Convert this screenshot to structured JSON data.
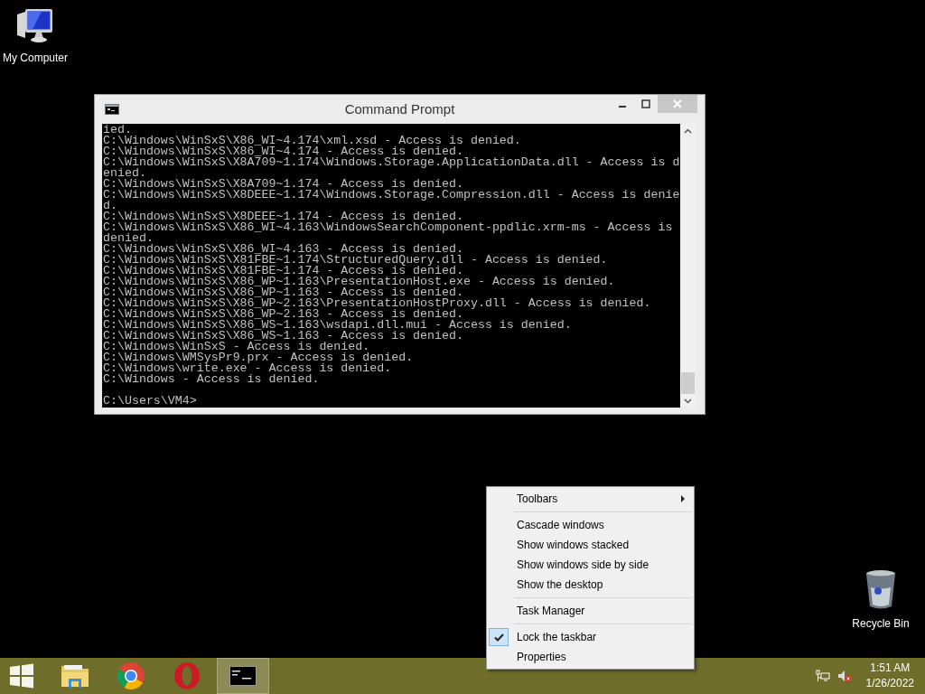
{
  "desktop_icons": [
    {
      "kind": "computer",
      "label": "My Computer"
    },
    {
      "kind": "recycle",
      "label": "Recycle Bin"
    }
  ],
  "window": {
    "title": "Command Prompt",
    "lines": [
      "ied.",
      "C:\\Windows\\WinSxS\\X86_WI~4.174\\xml.xsd - Access is denied.",
      "C:\\Windows\\WinSxS\\X86_WI~4.174 - Access is denied.",
      "C:\\Windows\\WinSxS\\X8A709~1.174\\Windows.Storage.ApplicationData.dll - Access is d",
      "enied.",
      "C:\\Windows\\WinSxS\\X8A709~1.174 - Access is denied.",
      "C:\\Windows\\WinSxS\\X8DEEE~1.174\\Windows.Storage.Compression.dll - Access is denie",
      "d.",
      "C:\\Windows\\WinSxS\\X8DEEE~1.174 - Access is denied.",
      "C:\\Windows\\WinSxS\\X86_WI~4.163\\WindowsSearchComponent-ppdlic.xrm-ms - Access is",
      "denied.",
      "C:\\Windows\\WinSxS\\X86_WI~4.163 - Access is denied.",
      "C:\\Windows\\WinSxS\\X81FBE~1.174\\StructuredQuery.dll - Access is denied.",
      "C:\\Windows\\WinSxS\\X81FBE~1.174 - Access is denied.",
      "C:\\Windows\\WinSxS\\X86_WP~1.163\\PresentationHost.exe - Access is denied.",
      "C:\\Windows\\WinSxS\\X86_WP~1.163 - Access is denied.",
      "C:\\Windows\\WinSxS\\X86_WP~2.163\\PresentationHostProxy.dll - Access is denied.",
      "C:\\Windows\\WinSxS\\X86_WP~2.163 - Access is denied.",
      "C:\\Windows\\WinSxS\\X86_WS~1.163\\wsdapi.dll.mui - Access is denied.",
      "C:\\Windows\\WinSxS\\X86_WS~1.163 - Access is denied.",
      "C:\\Windows\\WinSxS - Access is denied.",
      "C:\\Windows\\WMSysPr9.prx - Access is denied.",
      "C:\\Windows\\write.exe - Access is denied.",
      "C:\\Windows - Access is denied."
    ],
    "prompt": "C:\\Users\\VM4>"
  },
  "context_menu": {
    "groups": [
      {
        "items": [
          {
            "label": "Toolbars",
            "submenu": true,
            "checked": false
          }
        ]
      },
      {
        "items": [
          {
            "label": "Cascade windows",
            "submenu": false,
            "checked": false
          },
          {
            "label": "Show windows stacked",
            "submenu": false,
            "checked": false
          },
          {
            "label": "Show windows side by side",
            "submenu": false,
            "checked": false
          },
          {
            "label": "Show the desktop",
            "submenu": false,
            "checked": false
          }
        ]
      },
      {
        "items": [
          {
            "label": "Task Manager",
            "submenu": false,
            "checked": false
          }
        ]
      },
      {
        "items": [
          {
            "label": "Lock the taskbar",
            "submenu": false,
            "checked": true
          },
          {
            "label": "Properties",
            "submenu": false,
            "checked": false
          }
        ]
      }
    ]
  },
  "taskbar": {
    "apps": [
      {
        "kind": "explorer",
        "selected": false
      },
      {
        "kind": "chrome",
        "selected": false
      },
      {
        "kind": "opera",
        "selected": false
      },
      {
        "kind": "cmd",
        "selected": true
      }
    ],
    "time": "1:51 AM",
    "date": "1/26/2022"
  }
}
